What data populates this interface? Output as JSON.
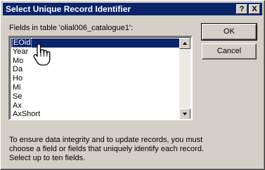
{
  "window": {
    "title": "Select Unique Record Identifier",
    "help_glyph": "?",
    "close_glyph": "X"
  },
  "fields_label": "Fields in table 'olial006_catalogue1':",
  "fields": [
    "EOid",
    "Year",
    "Mo",
    "Da",
    "Ho",
    "Mi",
    "Se",
    "Ax",
    "AxShort"
  ],
  "selected_field": "EOid",
  "buttons": {
    "ok": "OK",
    "cancel": "Cancel"
  },
  "help_text": "To ensure data integrity and to update records, you must choose a field or fields that uniquely identify each record. Select up to ten fields.",
  "colors": {
    "titlebar": "#0a246a",
    "selection": "#0a246a",
    "face": "#d4d0c8"
  },
  "cursor_icon": "hand-pointer-icon"
}
